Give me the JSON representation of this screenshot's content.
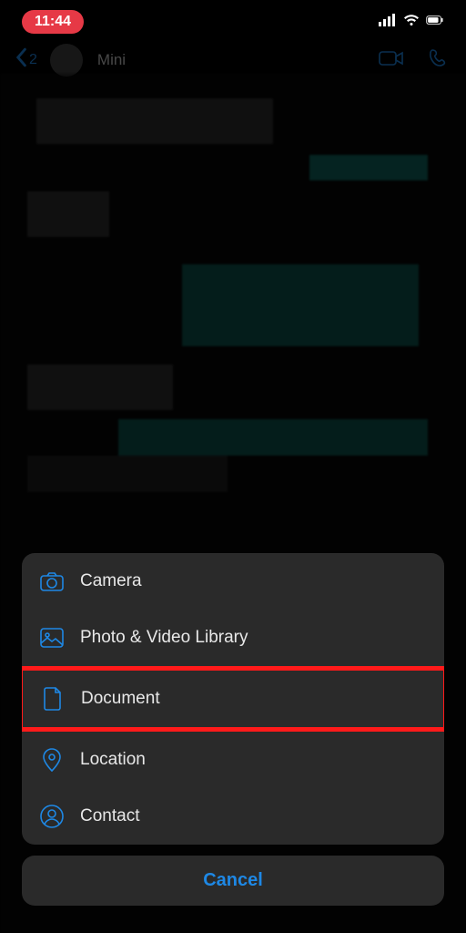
{
  "status": {
    "time": "11:44"
  },
  "header": {
    "back_count": "2",
    "contact_name": "Mini"
  },
  "sheet": {
    "items": [
      {
        "label": "Camera",
        "icon": "camera-icon"
      },
      {
        "label": "Photo & Video Library",
        "icon": "gallery-icon"
      },
      {
        "label": "Document",
        "icon": "document-icon"
      },
      {
        "label": "Location",
        "icon": "location-icon"
      },
      {
        "label": "Contact",
        "icon": "contact-icon"
      }
    ],
    "cancel_label": "Cancel"
  },
  "highlighted_index": 2,
  "colors": {
    "accent": "#1e88e5",
    "time_pill": "#e63946",
    "highlight": "#ff1a1a",
    "sheet_bg": "#2a2a2a"
  }
}
